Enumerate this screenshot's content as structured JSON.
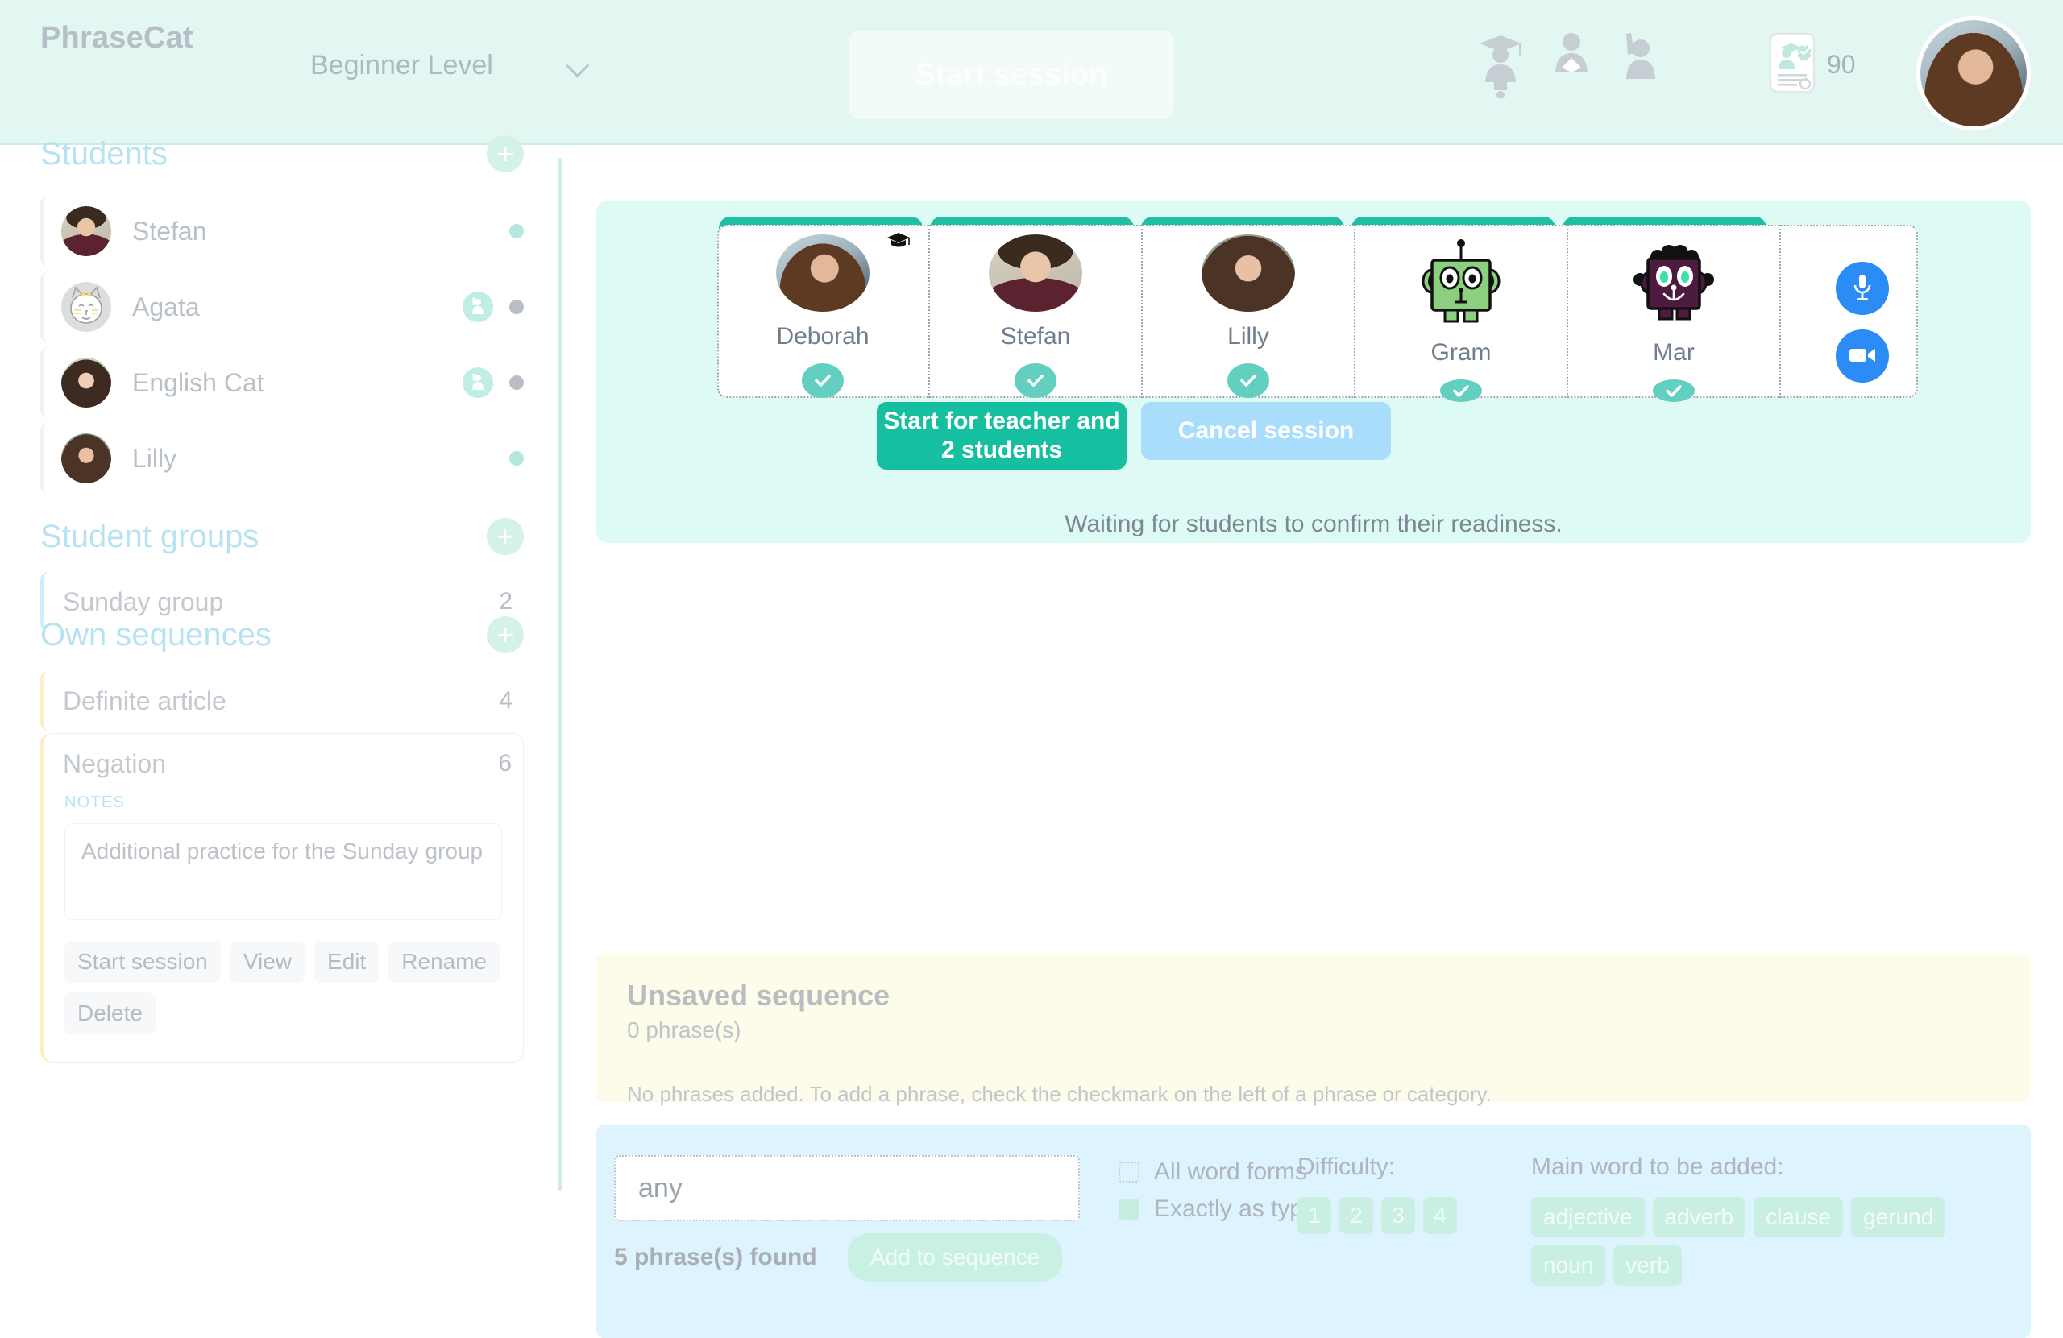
{
  "header": {
    "brand": "PhraseCat",
    "level": "Beginner Level",
    "level_chevron_icon": "chevron-down-icon",
    "start_session_label": "Start session",
    "icons": [
      "teacher-icon",
      "student-icon",
      "raised-hand-icon"
    ],
    "score": "90",
    "score_icon": "certificate-card-icon",
    "avatar_icon": "user-avatar"
  },
  "sidebar": {
    "students": {
      "title": "Students",
      "add_label": "+",
      "items": [
        {
          "name": "Stefan",
          "avatar": "photo-stefan",
          "hand_raised": false,
          "status": "online"
        },
        {
          "name": "Agata",
          "avatar": "photo-agata",
          "hand_raised": true,
          "status": "offline"
        },
        {
          "name": "English Cat",
          "avatar": "photo-englishcat",
          "hand_raised": true,
          "status": "offline"
        },
        {
          "name": "Lilly",
          "avatar": "photo-lilly",
          "hand_raised": false,
          "status": "online"
        }
      ]
    },
    "student_groups": {
      "title": "Student groups",
      "add_label": "+",
      "items": [
        {
          "name": "Sunday group",
          "count": "2"
        }
      ]
    },
    "own_sequences": {
      "title": "Own sequences",
      "add_label": "+",
      "items": [
        {
          "name": "Definite article",
          "count": "4"
        }
      ],
      "expanded": {
        "name": "Negation",
        "count": "6",
        "notes_label": "NOTES",
        "notes_value": "Additional practice for the Sunday group",
        "actions": [
          "Start session",
          "View",
          "Edit",
          "Rename",
          "Delete"
        ]
      }
    }
  },
  "session": {
    "participants": [
      {
        "name": "Deborah",
        "avatar": "photo-deborah",
        "is_teacher": true,
        "confirmed": true
      },
      {
        "name": "Stefan",
        "avatar": "photo-stefan",
        "is_teacher": false,
        "confirmed": true
      },
      {
        "name": "Lilly",
        "avatar": "photo-lilly",
        "is_teacher": false,
        "confirmed": true
      },
      {
        "name": "Gram",
        "avatar": "robot-green",
        "is_teacher": false,
        "confirmed": true
      },
      {
        "name": "Mar",
        "avatar": "robot-purple",
        "is_teacher": false,
        "confirmed": true
      }
    ],
    "mic_icon": "microphone-icon",
    "video_icon": "video-camera-icon",
    "start_label": "Start for teacher and\n2 students",
    "start_label_line1": "Start for teacher and",
    "start_label_line2": "2 students",
    "cancel_label": "Cancel session",
    "waiting_text": "Waiting for students to confirm their readiness."
  },
  "unsaved": {
    "title": "Unsaved sequence",
    "count_text": "0 phrase(s)",
    "empty_text": "No phrases added. To add a phrase, check the checkmark on the left of a phrase or category."
  },
  "search": {
    "value": "any",
    "placeholder": "any",
    "found_text": "5 phrase(s) found",
    "add_label": "Add to sequence",
    "checkboxes": [
      {
        "label": "All word forms",
        "checked": false
      },
      {
        "label": "Exactly as typed",
        "checked": true
      }
    ],
    "difficulty_label": "Difficulty:",
    "difficulty_options": [
      "1",
      "2",
      "3",
      "4"
    ],
    "word_label": "Main word to be added:",
    "word_options": [
      "adjective",
      "adverb",
      "clause",
      "gerund",
      "noun",
      "verb"
    ]
  },
  "colors": {
    "header_bg": "#e2f6f2",
    "teal": "#16bfa0",
    "panel_teal": "#defaf4",
    "panel_yellow": "#fdfbea",
    "panel_blue": "#ddf3fd",
    "accent_blue": "#2a8cf4",
    "check_green": "#62cfc0"
  }
}
